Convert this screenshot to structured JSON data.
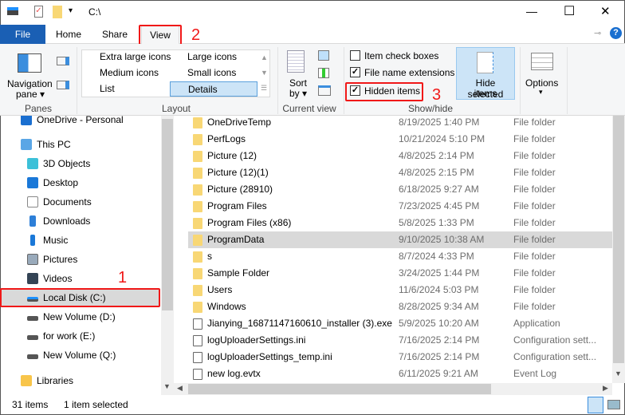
{
  "title_bar": {
    "path": "C:\\",
    "minimize": "—",
    "maximize": "☐",
    "close": "✕"
  },
  "tabs": [
    {
      "label": "File"
    },
    {
      "label": "Home"
    },
    {
      "label": "Share"
    },
    {
      "label": "View"
    }
  ],
  "ribbon": {
    "panes": {
      "navigation_pane": "Navigation",
      "navigation_pane2": "pane ▾",
      "group": "Panes"
    },
    "layout": {
      "items": [
        "Extra large icons",
        "Large icons",
        "Medium icons",
        "Small icons",
        "List",
        "Details"
      ],
      "selected": "Details",
      "group": "Layout"
    },
    "current_view": {
      "sort": "Sort",
      "sort2": "by ▾",
      "group": "Current view"
    },
    "show_hide": {
      "item_check_boxes": "Item check boxes",
      "item_check_boxes_checked": false,
      "file_name_extensions": "File name extensions",
      "file_name_extensions_checked": true,
      "hidden_items": "Hidden items",
      "hidden_items_checked": true,
      "hide_selected": "Hide selected",
      "hide_selected2": "items",
      "group": "Show/hide"
    },
    "options": {
      "label": "Options",
      "arrow": "▾"
    }
  },
  "annotations": [
    "1",
    "2",
    "3"
  ],
  "nav": [
    {
      "label": "OneDrive - Personal",
      "icon": "cloud-icon",
      "level": 0
    },
    {
      "label": "This PC",
      "icon": "computer-icon",
      "level": 0
    },
    {
      "label": "3D Objects",
      "icon": "cube-icon",
      "level": 1
    },
    {
      "label": "Desktop",
      "icon": "desktop-icon",
      "level": 1
    },
    {
      "label": "Documents",
      "icon": "document-icon",
      "level": 1
    },
    {
      "label": "Downloads",
      "icon": "download-icon",
      "level": 1
    },
    {
      "label": "Music",
      "icon": "music-icon",
      "level": 1
    },
    {
      "label": "Pictures",
      "icon": "picture-icon",
      "level": 1
    },
    {
      "label": "Videos",
      "icon": "video-icon",
      "level": 1
    },
    {
      "label": "Local Disk (C:)",
      "icon": "drive-icon",
      "level": 1,
      "selected": true
    },
    {
      "label": "New Volume (D:)",
      "icon": "drive-icon",
      "level": 1
    },
    {
      "label": "for work (E:)",
      "icon": "drive-icon",
      "level": 1
    },
    {
      "label": "New Volume (Q:)",
      "icon": "drive-icon",
      "level": 1
    },
    {
      "label": "Libraries",
      "icon": "library-icon",
      "level": 0
    }
  ],
  "files": [
    {
      "name": "OneDriveTemp",
      "date": "8/19/2025 1:40 PM",
      "type": "File folder"
    },
    {
      "name": "PerfLogs",
      "date": "10/21/2024 5:10 PM",
      "type": "File folder"
    },
    {
      "name": "Picture (12)",
      "date": "4/8/2025 2:14 PM",
      "type": "File folder"
    },
    {
      "name": "Picture (12)(1)",
      "date": "4/8/2025 2:15 PM",
      "type": "File folder"
    },
    {
      "name": "Picture (28910)",
      "date": "6/18/2025 9:27 AM",
      "type": "File folder"
    },
    {
      "name": "Program Files",
      "date": "7/23/2025 4:45 PM",
      "type": "File folder"
    },
    {
      "name": "Program Files (x86)",
      "date": "5/8/2025 1:33 PM",
      "type": "File folder"
    },
    {
      "name": "ProgramData",
      "date": "9/10/2025 10:38 AM",
      "type": "File folder",
      "selected": true
    },
    {
      "name": "s",
      "date": "8/7/2024 4:33 PM",
      "type": "File folder"
    },
    {
      "name": "Sample Folder",
      "date": "3/24/2025 1:44 PM",
      "type": "File folder"
    },
    {
      "name": "Users",
      "date": "11/6/2024 5:03 PM",
      "type": "File folder"
    },
    {
      "name": "Windows",
      "date": "8/28/2025 9:34 AM",
      "type": "File folder"
    },
    {
      "name": "Jianying_16871147160610_installer (3).exe",
      "date": "5/9/2025 10:20 AM",
      "type": "Application"
    },
    {
      "name": "logUploaderSettings.ini",
      "date": "7/16/2025 2:14 PM",
      "type": "Configuration sett..."
    },
    {
      "name": "logUploaderSettings_temp.ini",
      "date": "7/16/2025 2:14 PM",
      "type": "Configuration sett..."
    },
    {
      "name": "new log.evtx",
      "date": "6/11/2025 9:21 AM",
      "type": "Event Log"
    }
  ],
  "status": {
    "count": "31 items",
    "selection": "1 item selected"
  },
  "colors": {
    "accent": "#1a5fb4",
    "annotation": "#f01818",
    "selected_bg": "#d9d9d9"
  }
}
